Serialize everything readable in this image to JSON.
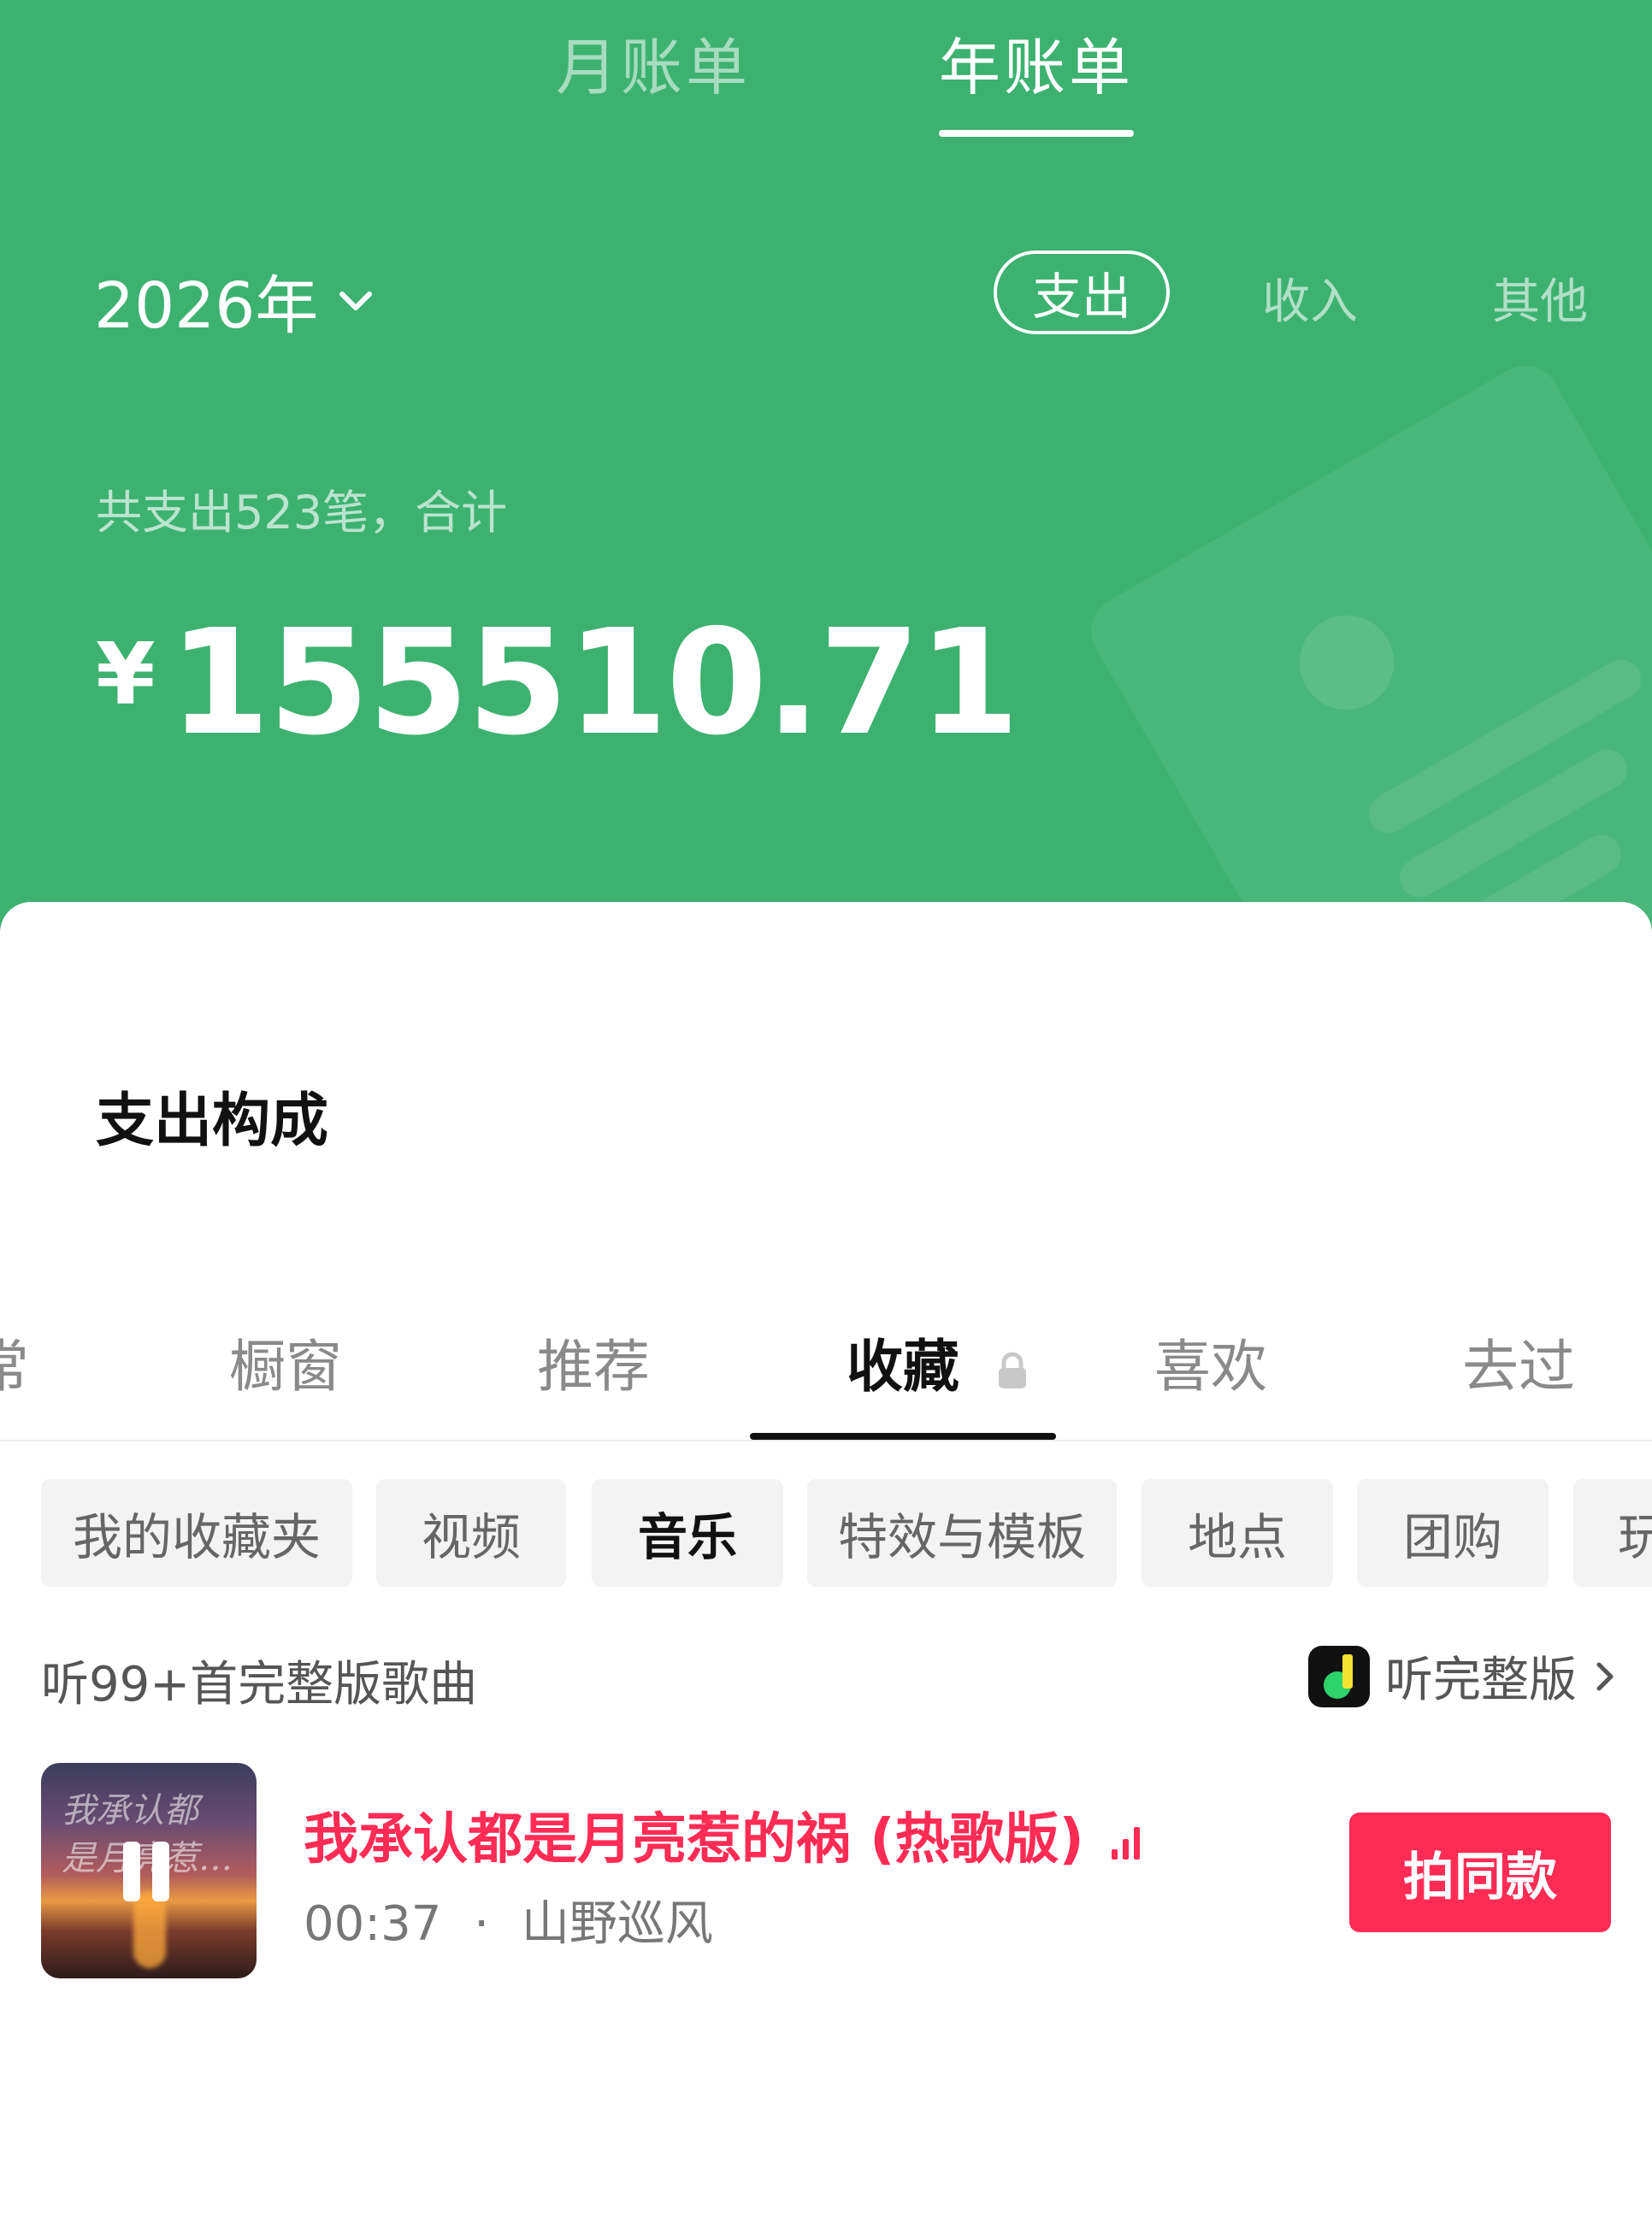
{
  "top_tabs": [
    {
      "label": "月账单",
      "active": false
    },
    {
      "label": "年账单",
      "active": true
    }
  ],
  "year_selector": {
    "label": "2026年"
  },
  "segments": {
    "expense": "支出",
    "income": "收入",
    "other": "其他",
    "active": "expense"
  },
  "summary_text": "共支出523笔，合计",
  "amount": {
    "currency": "¥",
    "value": "155510.71"
  },
  "section_title": "支出构成",
  "profile_tabs": [
    "常",
    "橱窗",
    "推荐",
    "收藏",
    "喜欢",
    "去过"
  ],
  "active_profile_tab": "收藏",
  "chips": [
    "我的收藏夹",
    "视频",
    "音乐",
    "特效与模板",
    "地点",
    "团购",
    "玩"
  ],
  "active_chip": "音乐",
  "listen_text": "听99+首完整版歌曲",
  "full_version_link": "听完整版",
  "song": {
    "title": "我承认都是月亮惹的祸 (热歌版)",
    "duration": "00:37",
    "separator": "·",
    "artist": "山野巡风",
    "cover_text_line1": "我承认都",
    "cover_text_line2": "是月亮惹…"
  },
  "shoot_button": "拍同款",
  "colors": {
    "header_green": "#3db270",
    "accent_red": "#fe2c55",
    "chip_bg": "#f3f3f4"
  }
}
